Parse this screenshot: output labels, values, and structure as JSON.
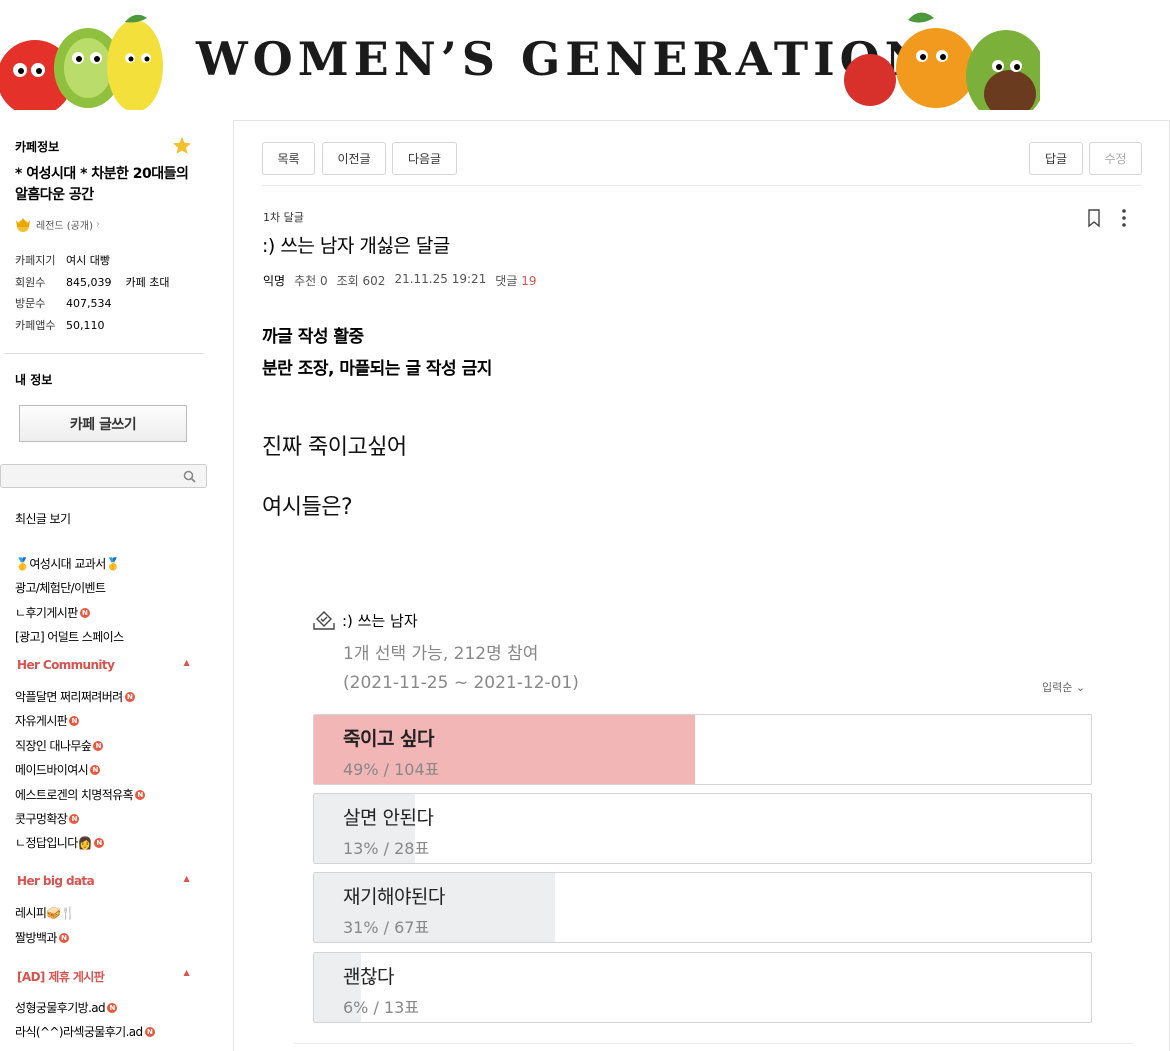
{
  "banner": {
    "title": "WOMEN’S GENERATION"
  },
  "sidebar": {
    "cafe_info_heading": "카페정보",
    "cafe_name": "* 여성시대 * 차분한 20대들의 알흠다운 공간",
    "level": "레전드 (공개)",
    "stats": [
      {
        "key": "카페지기",
        "value": "여시 대빵",
        "extra": ""
      },
      {
        "key": "회원수",
        "value": "845,039",
        "extra": "카페 초대"
      },
      {
        "key": "방문수",
        "value": "407,534",
        "extra": ""
      },
      {
        "key": "카페앱수",
        "value": "50,110",
        "extra": ""
      }
    ],
    "my_info": "내 정보",
    "write_button": "카페 글쓰기",
    "search_placeholder": "",
    "menu": {
      "latest": "최신글 보기",
      "textbook": "여성시대 교과서",
      "ads": "광고/체험단/이벤트",
      "review": "ㄴ후기게시판",
      "adult": "[광고] 어덜트 스페이스",
      "her_community": "Her Community",
      "community_items": [
        "악플달면 쩌리쩌려버려",
        "자유게시판",
        "직장인 대나무숲",
        "메이드바이여시",
        "에스트로겐의 치명적유혹",
        "콧구멍확장",
        "ㄴ정답입니다"
      ],
      "her_big_data": "Her big data",
      "bigdata_items": [
        "레시피",
        "짤방백과"
      ],
      "ad_board": "[AD] 제휴 게시판",
      "ad_items": [
        "성형궁물후기방.ad",
        "라식(^^)라섹궁물후기.ad"
      ]
    }
  },
  "toolbar": {
    "list": "목록",
    "prev": "이전글",
    "next": "다음글",
    "reply": "답글",
    "edit": "수정"
  },
  "post": {
    "board": "1차 달글",
    "title": ":) 쓰는 남자 개싫은 달글",
    "author": "익명",
    "recommend": "추천 0",
    "views": "조회 602",
    "date": "21.11.25 19:21",
    "comments_label": "댓글",
    "comments_count": "19",
    "notice_line1": "까글 작성 활중",
    "notice_line2": "분란 조장, 마플되는 글 작성 금지",
    "body_line1": "진짜 죽이고싶어",
    "body_line2": "여시들은?"
  },
  "poll": {
    "title": ":) 쓰는 남자",
    "info": "1개 선택 가능, 212명 참여",
    "period": "(2021-11-25 ~ 2021-12-01)",
    "sort": "입력순",
    "options": [
      {
        "label": "죽이고 싶다",
        "result": "49% / 104표",
        "percent": 49
      },
      {
        "label": "살면 안된다",
        "result": "13% / 28표",
        "percent": 13
      },
      {
        "label": "재기해야된다",
        "result": "31% / 67표",
        "percent": 31
      },
      {
        "label": "괜찮다",
        "result": "6% / 13표",
        "percent": 6
      }
    ]
  },
  "colors": {
    "accent": "#d9534f",
    "top_option": "#f2b6b6",
    "option_fill": "#eceef0"
  }
}
